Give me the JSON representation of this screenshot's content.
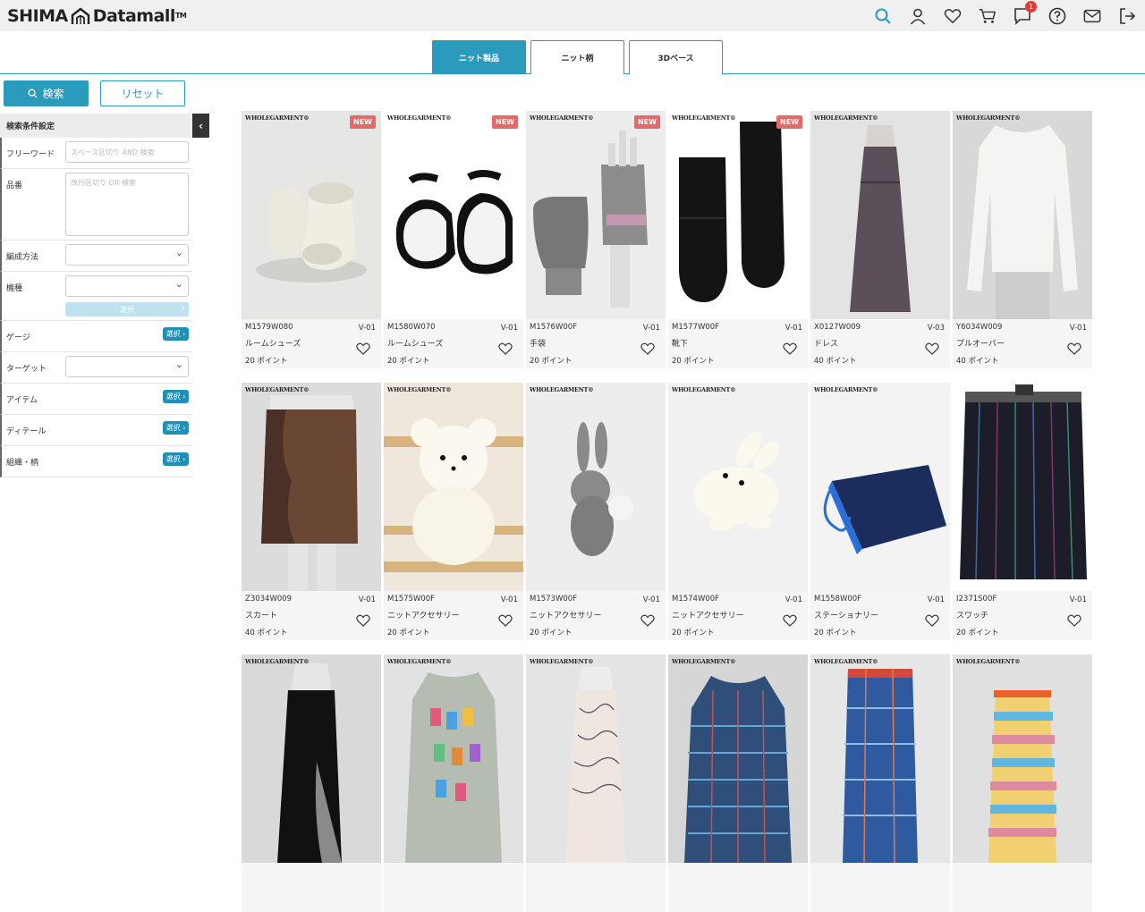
{
  "header": {
    "brand_left": "SHIMA",
    "brand_right": "Datamall",
    "trademark": "TM",
    "notification_count": "1"
  },
  "tabs": [
    {
      "label": "ニット製品",
      "active": true
    },
    {
      "label": "ニット柄",
      "active": false
    },
    {
      "label": "3Dベース",
      "active": false
    }
  ],
  "sidebar": {
    "search_label": "検索",
    "reset_label": "リセット",
    "cond_title": "検索条件設定",
    "freeword_label": "フリーワード",
    "freeword_placeholder": "スペース区切り AND 検索",
    "hinban_label": "品番",
    "hinban_placeholder": "改行区切り OR 検索",
    "method_label": "編成方法",
    "machine_label": "機種",
    "machine_select": "選択",
    "gauge_label": "ゲージ",
    "target_label": "ターゲット",
    "item_label": "アイテム",
    "detail_label": "ディテール",
    "pattern_label": "組織・柄",
    "pick_label": "選択 ›"
  },
  "card_common": {
    "brand": "WHOLEGARMENT®",
    "new_label": "NEW"
  },
  "products": [
    {
      "code": "M1579W080",
      "ver": "V-01",
      "name": "ルームシューズ",
      "points": "20 ポイント",
      "new": true
    },
    {
      "code": "M1580W070",
      "ver": "V-01",
      "name": "ルームシューズ",
      "points": "20 ポイント",
      "new": true
    },
    {
      "code": "M1576W00F",
      "ver": "V-01",
      "name": "手袋",
      "points": "20 ポイント",
      "new": true
    },
    {
      "code": "M1577W00F",
      "ver": "V-01",
      "name": "靴下",
      "points": "20 ポイント",
      "new": true
    },
    {
      "code": "X0127W009",
      "ver": "V-03",
      "name": "ドレス",
      "points": "40 ポイント",
      "new": false
    },
    {
      "code": "Y6034W009",
      "ver": "V-01",
      "name": "プルオーバー",
      "points": "40 ポイント",
      "new": false
    },
    {
      "code": "Z3034W009",
      "ver": "V-01",
      "name": "スカート",
      "points": "40 ポイント",
      "new": false
    },
    {
      "code": "M1575W00F",
      "ver": "V-01",
      "name": "ニットアクセサリー",
      "points": "20 ポイント",
      "new": false
    },
    {
      "code": "M1573W00F",
      "ver": "V-01",
      "name": "ニットアクセサリー",
      "points": "20 ポイント",
      "new": false
    },
    {
      "code": "M1574W00F",
      "ver": "V-01",
      "name": "ニットアクセサリー",
      "points": "20 ポイント",
      "new": false
    },
    {
      "code": "M1558W00F",
      "ver": "V-01",
      "name": "ステーショナリー",
      "points": "20 ポイント",
      "new": false
    },
    {
      "code": "I2371S00F",
      "ver": "V-01",
      "name": "スワッチ",
      "points": "20 ポイント",
      "new": false
    },
    {
      "code": "",
      "ver": "",
      "name": "",
      "points": "",
      "new": false
    },
    {
      "code": "",
      "ver": "",
      "name": "",
      "points": "",
      "new": false
    },
    {
      "code": "",
      "ver": "",
      "name": "",
      "points": "",
      "new": false
    },
    {
      "code": "",
      "ver": "",
      "name": "",
      "points": "",
      "new": false
    },
    {
      "code": "",
      "ver": "",
      "name": "",
      "points": "",
      "new": false
    },
    {
      "code": "",
      "ver": "",
      "name": "",
      "points": "",
      "new": false
    }
  ],
  "icons": [
    "search-icon",
    "user-icon",
    "heart-icon",
    "cart-icon",
    "chat-icon",
    "help-icon",
    "mail-icon",
    "logout-icon"
  ],
  "colors": {
    "accent": "#2a9bbd",
    "new_badge": "#e46a6a",
    "badge": "#e53935"
  }
}
